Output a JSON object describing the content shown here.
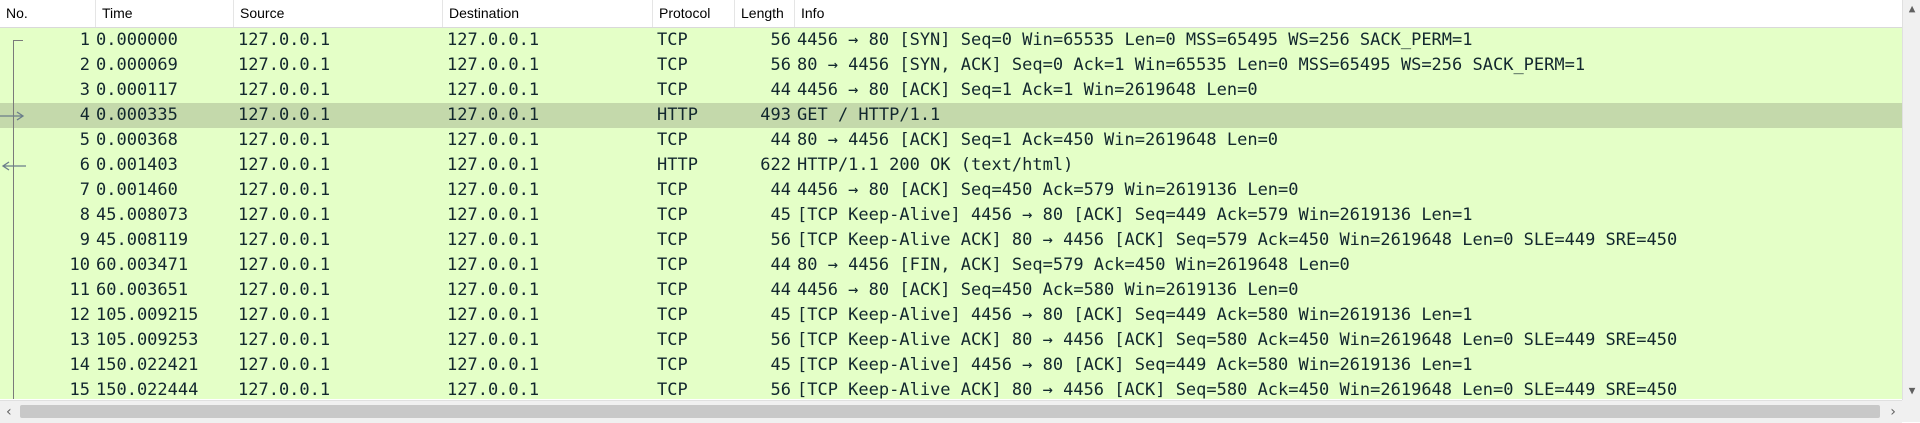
{
  "columns": {
    "no": "No.",
    "time": "Time",
    "source": "Source",
    "destination": "Destination",
    "protocol": "Protocol",
    "length": "Length",
    "info": "Info"
  },
  "selected_row": 4,
  "colors": {
    "row_bg": "#e4ffc7",
    "selected_bg": "#c4d9ab",
    "text": "#12272e"
  },
  "rows": [
    {
      "no": "1",
      "time": "0.000000",
      "source": "127.0.0.1",
      "destination": "127.0.0.1",
      "protocol": "TCP",
      "length": "56",
      "info": "4456 → 80 [SYN] Seq=0 Win=65535 Len=0 MSS=65495 WS=256 SACK_PERM=1"
    },
    {
      "no": "2",
      "time": "0.000069",
      "source": "127.0.0.1",
      "destination": "127.0.0.1",
      "protocol": "TCP",
      "length": "56",
      "info": "80 → 4456 [SYN, ACK] Seq=0 Ack=1 Win=65535 Len=0 MSS=65495 WS=256 SACK_PERM=1"
    },
    {
      "no": "3",
      "time": "0.000117",
      "source": "127.0.0.1",
      "destination": "127.0.0.1",
      "protocol": "TCP",
      "length": "44",
      "info": "4456 → 80 [ACK] Seq=1 Ack=1 Win=2619648 Len=0"
    },
    {
      "no": "4",
      "time": "0.000335",
      "source": "127.0.0.1",
      "destination": "127.0.0.1",
      "protocol": "HTTP",
      "length": "493",
      "info": "GET / HTTP/1.1"
    },
    {
      "no": "5",
      "time": "0.000368",
      "source": "127.0.0.1",
      "destination": "127.0.0.1",
      "protocol": "TCP",
      "length": "44",
      "info": "80 → 4456 [ACK] Seq=1 Ack=450 Win=2619648 Len=0"
    },
    {
      "no": "6",
      "time": "0.001403",
      "source": "127.0.0.1",
      "destination": "127.0.0.1",
      "protocol": "HTTP",
      "length": "622",
      "info": "HTTP/1.1 200 OK  (text/html)"
    },
    {
      "no": "7",
      "time": "0.001460",
      "source": "127.0.0.1",
      "destination": "127.0.0.1",
      "protocol": "TCP",
      "length": "44",
      "info": "4456 → 80 [ACK] Seq=450 Ack=579 Win=2619136 Len=0"
    },
    {
      "no": "8",
      "time": "45.008073",
      "source": "127.0.0.1",
      "destination": "127.0.0.1",
      "protocol": "TCP",
      "length": "45",
      "info": "[TCP Keep-Alive] 4456 → 80 [ACK] Seq=449 Ack=579 Win=2619136 Len=1"
    },
    {
      "no": "9",
      "time": "45.008119",
      "source": "127.0.0.1",
      "destination": "127.0.0.1",
      "protocol": "TCP",
      "length": "56",
      "info": "[TCP Keep-Alive ACK] 80 → 4456 [ACK] Seq=579 Ack=450 Win=2619648 Len=0 SLE=449 SRE=450"
    },
    {
      "no": "10",
      "time": "60.003471",
      "source": "127.0.0.1",
      "destination": "127.0.0.1",
      "protocol": "TCP",
      "length": "44",
      "info": "80 → 4456 [FIN, ACK] Seq=579 Ack=450 Win=2619648 Len=0"
    },
    {
      "no": "11",
      "time": "60.003651",
      "source": "127.0.0.1",
      "destination": "127.0.0.1",
      "protocol": "TCP",
      "length": "44",
      "info": "4456 → 80 [ACK] Seq=450 Ack=580 Win=2619136 Len=0"
    },
    {
      "no": "12",
      "time": "105.009215",
      "source": "127.0.0.1",
      "destination": "127.0.0.1",
      "protocol": "TCP",
      "length": "45",
      "info": "[TCP Keep-Alive] 4456 → 80 [ACK] Seq=449 Ack=580 Win=2619136 Len=1"
    },
    {
      "no": "13",
      "time": "105.009253",
      "source": "127.0.0.1",
      "destination": "127.0.0.1",
      "protocol": "TCP",
      "length": "56",
      "info": "[TCP Keep-Alive ACK] 80 → 4456 [ACK] Seq=580 Ack=450 Win=2619648 Len=0 SLE=449 SRE=450"
    },
    {
      "no": "14",
      "time": "150.022421",
      "source": "127.0.0.1",
      "destination": "127.0.0.1",
      "protocol": "TCP",
      "length": "45",
      "info": "[TCP Keep-Alive] 4456 → 80 [ACK] Seq=449 Ack=580 Win=2619136 Len=1"
    },
    {
      "no": "15",
      "time": "150.022444",
      "source": "127.0.0.1",
      "destination": "127.0.0.1",
      "protocol": "TCP",
      "length": "56",
      "info": "[TCP Keep-Alive ACK] 80 → 4456 [ACK] Seq=580 Ack=450 Win=2619648 Len=0 SLE=449 SRE=450"
    }
  ],
  "icons": {
    "scroll_up": "chevron-up-icon",
    "scroll_down": "chevron-down-icon",
    "scroll_left": "chevron-left-icon",
    "scroll_right": "chevron-right-icon"
  }
}
